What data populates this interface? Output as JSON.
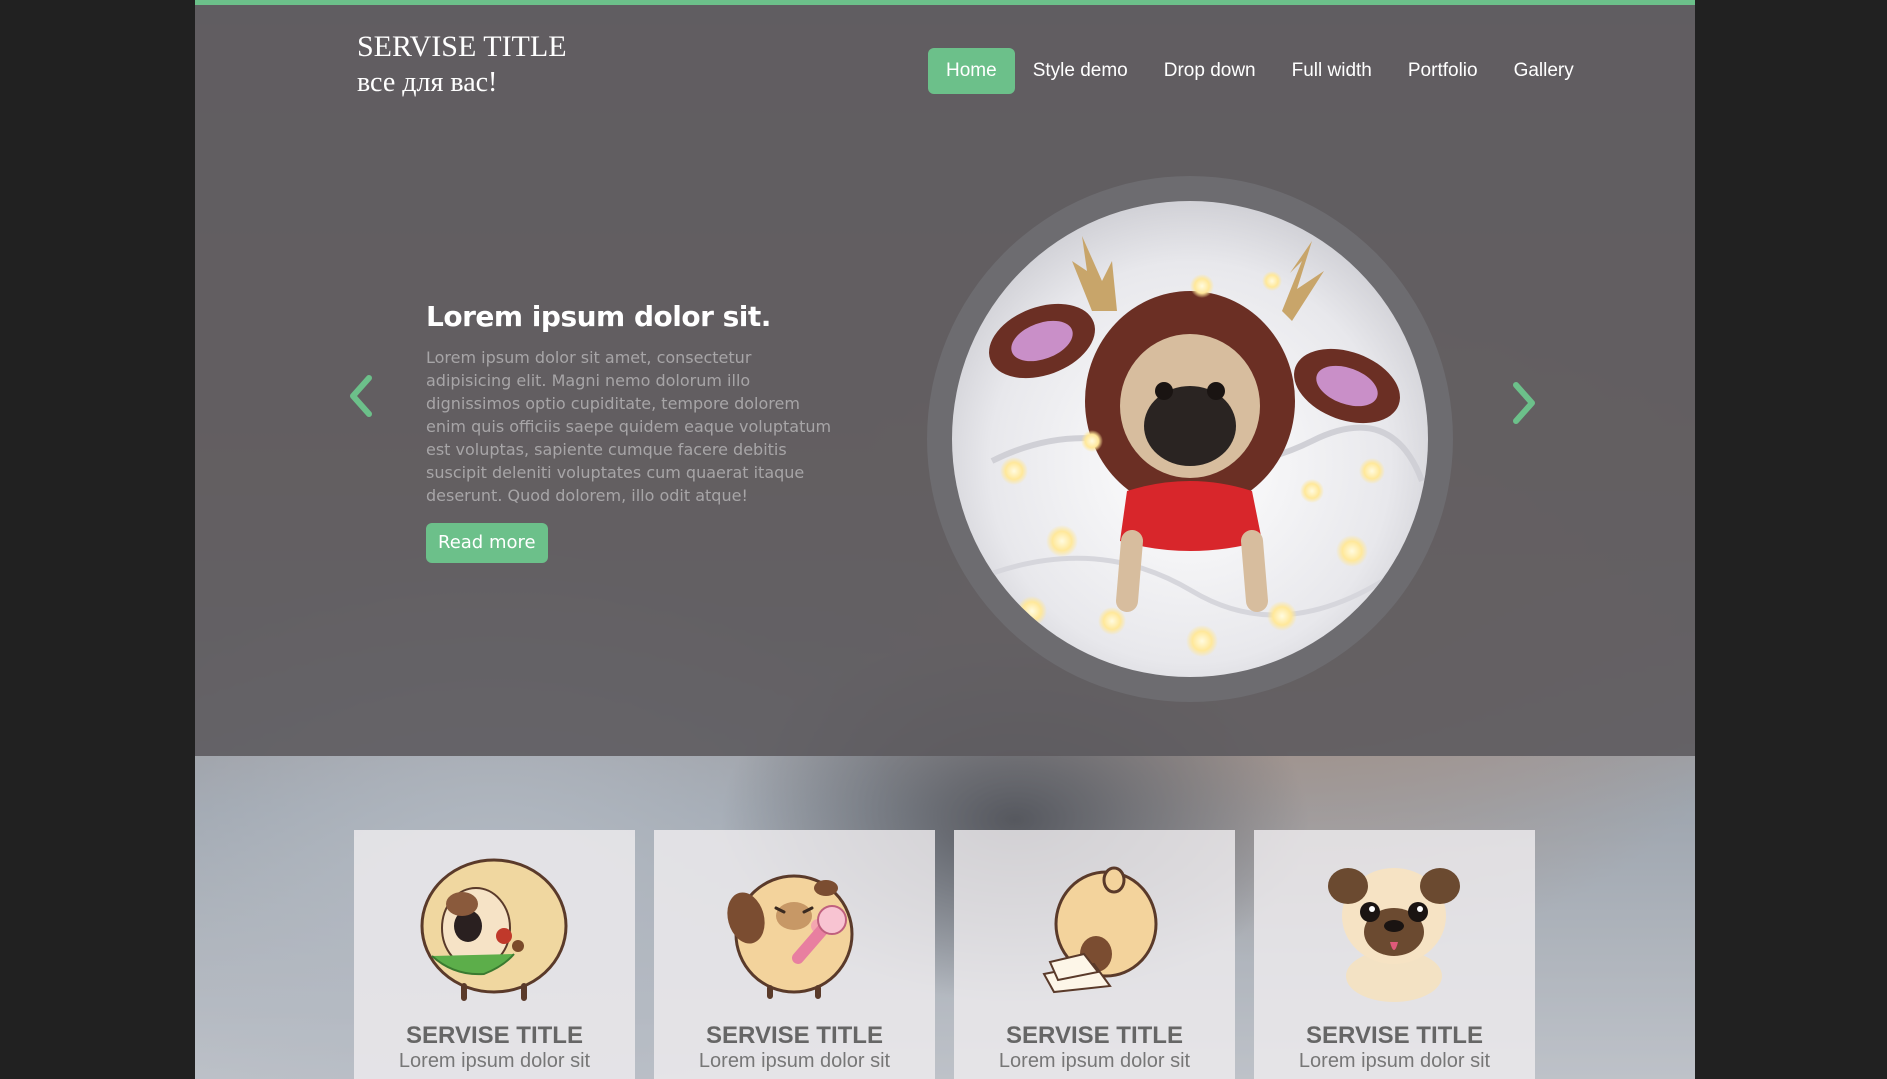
{
  "header": {
    "title": "SERVISE TITLE",
    "subtitle": "все для вас!"
  },
  "nav": {
    "items": [
      {
        "label": "Home",
        "active": true
      },
      {
        "label": "Style demo",
        "active": false
      },
      {
        "label": "Drop down",
        "active": false
      },
      {
        "label": "Full width",
        "active": false
      },
      {
        "label": "Portfolio",
        "active": false
      },
      {
        "label": "Gallery",
        "active": false
      }
    ]
  },
  "slider": {
    "title": "Lorem ipsum dolor sit.",
    "text": "Lorem ipsum dolor sit amet, consectetur adipisicing elit. Magni nemo dolorum illo dignissimos optio cupiditate, tempore dolorem enim quis officiis saepe quidem eaque voluptatum est voluptas, sapiente cumque facere debitis suscipit deleniti voluptates cum quaerat itaque deserunt. Quod dolorem, illo odit atque!",
    "button_label": "Read more",
    "prev_icon": "chevron-left-icon",
    "next_icon": "chevron-right-icon"
  },
  "services": [
    {
      "title": "SERVISE TITLE",
      "text": "Lorem ipsum dolor sit",
      "icon": "pug-burrito-icon"
    },
    {
      "title": "SERVISE TITLE",
      "text": "Lorem ipsum dolor sit",
      "icon": "pug-singing-icon"
    },
    {
      "title": "SERVISE TITLE",
      "text": "Lorem ipsum dolor sit",
      "icon": "pug-sitting-icon"
    },
    {
      "title": "SERVISE TITLE",
      "text": "Lorem ipsum dolor sit",
      "icon": "pug-puppy-icon"
    }
  ],
  "colors": {
    "accent": "#6cc08a",
    "background": "#212121",
    "hero_overlay": "#605e62"
  }
}
